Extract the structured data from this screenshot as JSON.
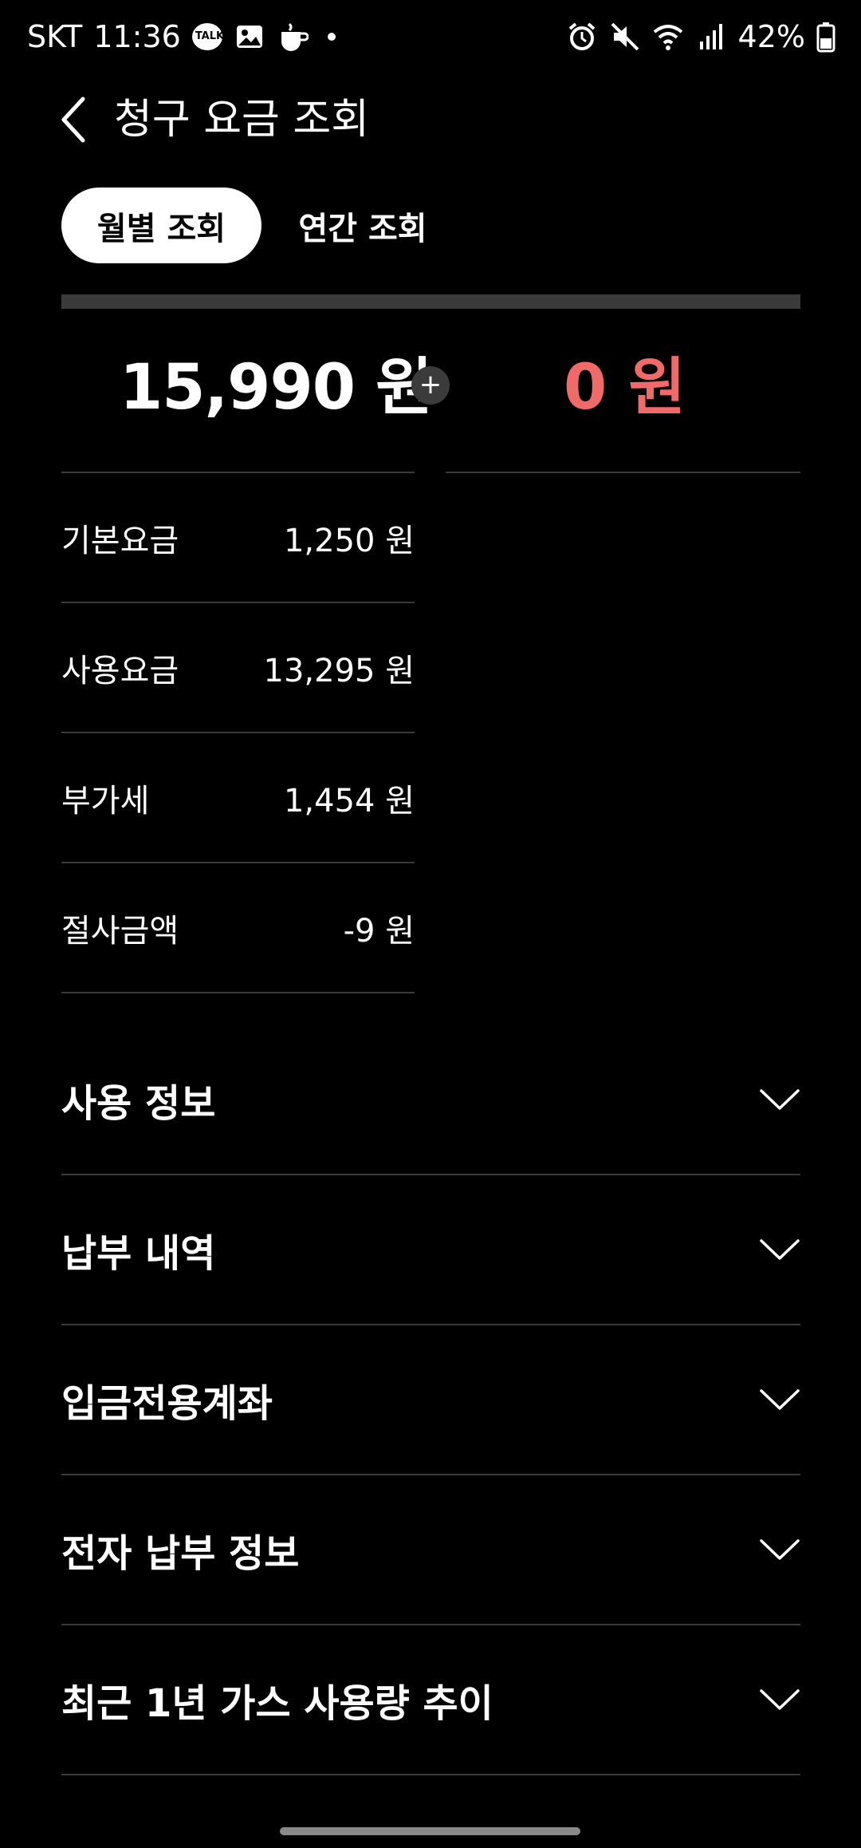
{
  "status_bar": {
    "carrier": "SKT",
    "time": "11:36",
    "talk_badge": "TALK",
    "battery": "42%",
    "left_icons": [
      "kakaotalk-icon",
      "gallery-icon",
      "coffee-app-icon",
      "notification-dot"
    ],
    "right_icons": [
      "alarm-icon",
      "mute-icon",
      "wifi-icon",
      "signal-icon",
      "battery-icon"
    ]
  },
  "header": {
    "title": "청구 요금 조회"
  },
  "tabs": {
    "monthly": "월별 조회",
    "yearly": "연간 조회"
  },
  "totals": {
    "billed": "15,990 원",
    "plus_symbol": "+",
    "extra": "0 원",
    "extra_color": "#f06a6a"
  },
  "breakdown": [
    {
      "label": "기본요금",
      "value": "1,250 원"
    },
    {
      "label": "사용요금",
      "value": "13,295 원"
    },
    {
      "label": "부가세",
      "value": "1,454 원"
    },
    {
      "label": "절사금액",
      "value": "-9 원"
    }
  ],
  "sections": [
    {
      "title": "사용 정보"
    },
    {
      "title": "납부 내역"
    },
    {
      "title": "입금전용계좌"
    },
    {
      "title": "전자 납부 정보"
    },
    {
      "title": "최근 1년 가스 사용량 추이"
    }
  ],
  "colors": {
    "background": "#000000",
    "accent_red": "#f06a6a",
    "divider": "#3a3a3a"
  }
}
